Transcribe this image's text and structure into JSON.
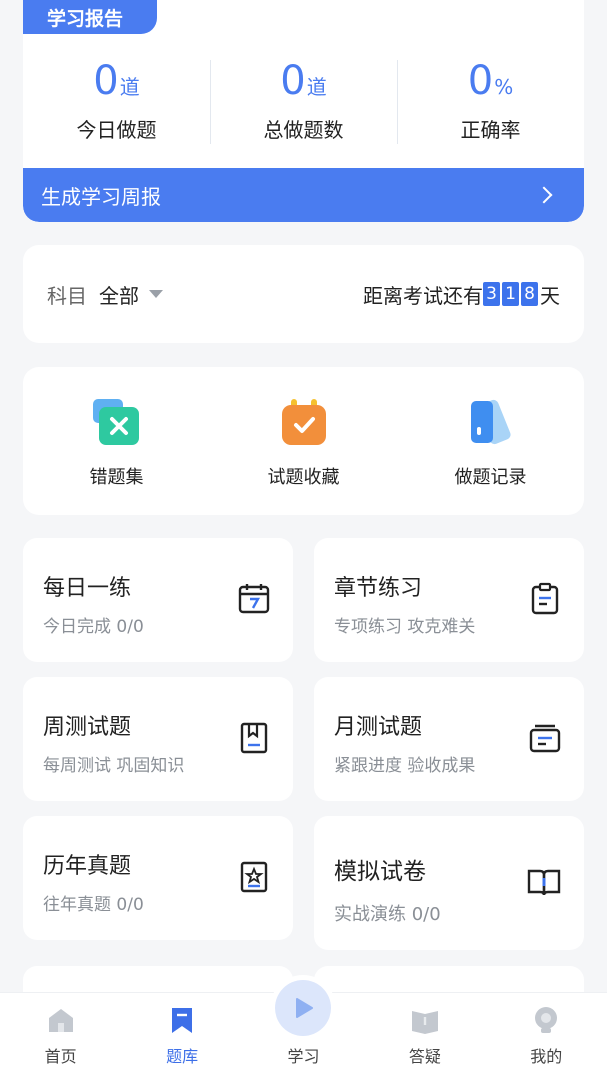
{
  "report": {
    "tab": "学习报告",
    "stats": [
      {
        "value": "0",
        "unit": "道",
        "label": "今日做题"
      },
      {
        "value": "0",
        "unit": "道",
        "label": "总做题数"
      },
      {
        "value": "0",
        "unit": "%",
        "label": "正确率"
      }
    ],
    "weekly_label": "生成学习周报"
  },
  "subject": {
    "label": "科目",
    "value": "全部",
    "exam_prefix": "距离考试还有",
    "days_digits": [
      "3",
      "1",
      "8"
    ],
    "exam_suffix": "天"
  },
  "tools": [
    {
      "label": "错题集",
      "icon": "wrong-questions-icon"
    },
    {
      "label": "试题收藏",
      "icon": "favorites-icon"
    },
    {
      "label": "做题记录",
      "icon": "records-icon"
    }
  ],
  "grid": [
    {
      "title": "每日一练",
      "subtitle": "今日完成 0/0",
      "icon": "calendar-icon"
    },
    {
      "title": "章节练习",
      "subtitle": "专项练习 攻克难关",
      "icon": "clipboard-icon"
    },
    {
      "title": "周测试题",
      "subtitle": "每周测试 巩固知识",
      "icon": "bookmark-doc-icon"
    },
    {
      "title": "月测试题",
      "subtitle": "紧跟进度 验收成果",
      "icon": "folder-icon"
    },
    {
      "title": "历年真题",
      "subtitle": "往年真题 0/0",
      "icon": "star-doc-icon"
    },
    {
      "title": "模拟试卷",
      "subtitle": "实战演练 0/0",
      "icon": "open-book-icon"
    }
  ],
  "nav": [
    {
      "label": "首页",
      "icon": "home-icon"
    },
    {
      "label": "题库",
      "icon": "question-bank-icon"
    },
    {
      "label": "学习",
      "icon": "play-icon"
    },
    {
      "label": "答疑",
      "icon": "qa-book-icon"
    },
    {
      "label": "我的",
      "icon": "profile-icon"
    }
  ],
  "colors": {
    "accent": "#4a7cf0",
    "background": "#f5f6f8"
  }
}
